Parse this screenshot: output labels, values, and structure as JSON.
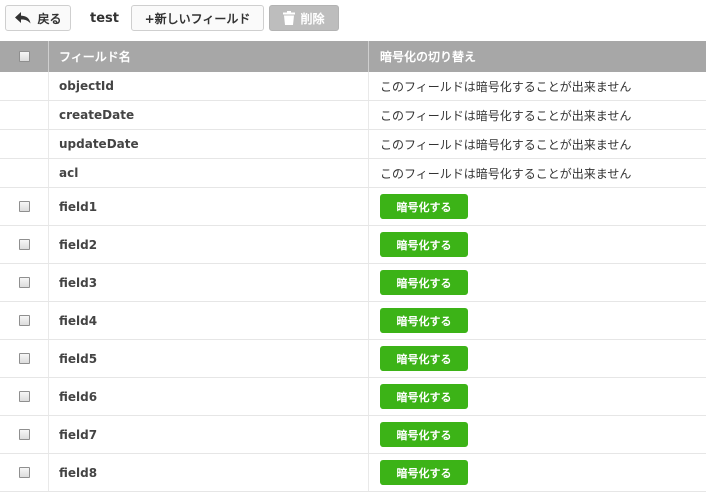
{
  "toolbar": {
    "back_label": "戻る",
    "back_icon": "reply-arrow-icon",
    "collection_name": "test",
    "new_field_label": "+新しいフィールド",
    "delete_label": "削除",
    "delete_icon": "trash-icon"
  },
  "table": {
    "headers": {
      "name": "フィールド名",
      "encryption": "暗号化の切り替え"
    },
    "system_fields": [
      {
        "name": "objectId",
        "note": "このフィールドは暗号化することが出来ません"
      },
      {
        "name": "createDate",
        "note": "このフィールドは暗号化することが出来ません"
      },
      {
        "name": "updateDate",
        "note": "このフィールドは暗号化することが出来ません"
      },
      {
        "name": "acl",
        "note": "このフィールドは暗号化することが出来ません"
      }
    ],
    "user_fields": [
      {
        "name": "field1",
        "button": "暗号化する"
      },
      {
        "name": "field2",
        "button": "暗号化する"
      },
      {
        "name": "field3",
        "button": "暗号化する"
      },
      {
        "name": "field4",
        "button": "暗号化する"
      },
      {
        "name": "field5",
        "button": "暗号化する"
      },
      {
        "name": "field6",
        "button": "暗号化する"
      },
      {
        "name": "field7",
        "button": "暗号化する"
      },
      {
        "name": "field8",
        "button": "暗号化する"
      }
    ]
  },
  "colors": {
    "header_bg": "#a7a7a7",
    "encrypt_button": "#3cb317",
    "disabled_button": "#bdbdbd"
  }
}
